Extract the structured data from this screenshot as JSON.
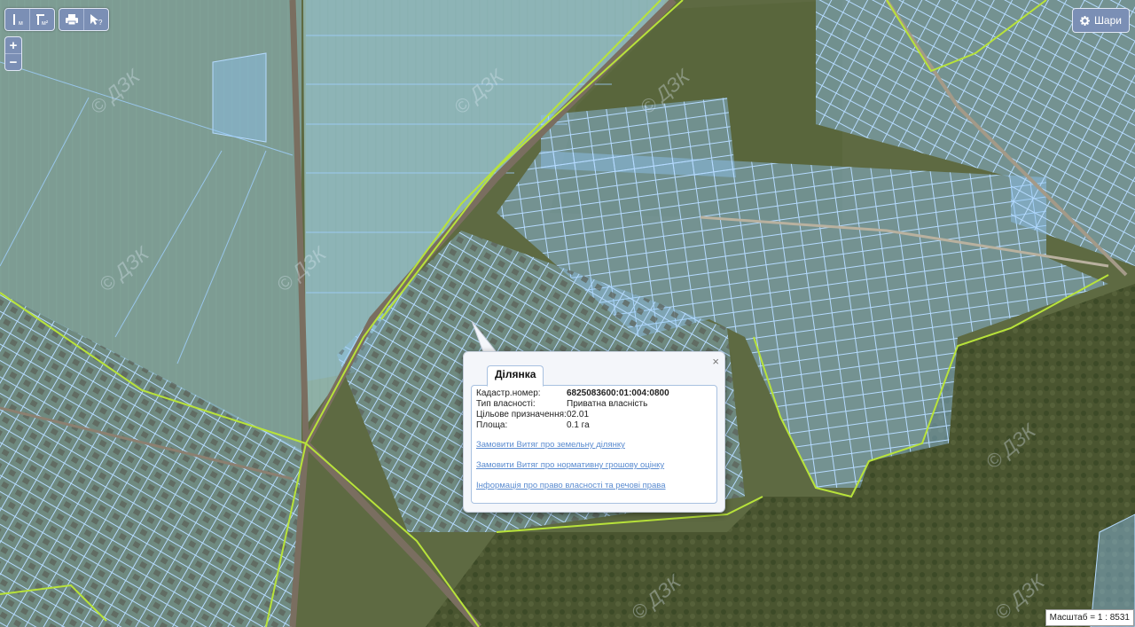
{
  "toolbar": {
    "groups": [
      {
        "buttons": [
          {
            "icon": "measure-length-icon",
            "label": "м"
          },
          {
            "icon": "measure-area-icon",
            "label": "м²"
          }
        ]
      },
      {
        "buttons": [
          {
            "icon": "print-icon"
          },
          {
            "icon": "identify-cursor-icon"
          }
        ]
      }
    ]
  },
  "zoom": {
    "in": "+",
    "out": "−"
  },
  "layers_button": {
    "icon": "gear-icon",
    "label": "Шари"
  },
  "popup": {
    "tab": "Ділянка",
    "close": "×",
    "rows": [
      {
        "label": "Кадастр.номер:",
        "value": "6825083600:01:004:0800"
      },
      {
        "label": "Тип власності:",
        "value": "Приватна власність"
      },
      {
        "label": "Цільове призначення:",
        "value": "02.01"
      },
      {
        "label": "Площа:",
        "value": "0.1 га"
      }
    ],
    "links": [
      "Замовити Витяг про земельну ділянку",
      "Замовити Витяг про нормативну грошову оцінку",
      "Інформація про право власності та речові права"
    ]
  },
  "scale": "Масштаб = 1 : 8531",
  "watermark": "© ДЗК",
  "colors": {
    "parcel_fill": "#8fc4f2",
    "parcel_stroke": "#6ab0ee",
    "boundary": "#b8e33a",
    "field": "#6d8a74",
    "road": "#8c8071",
    "forest": "#46502c"
  }
}
